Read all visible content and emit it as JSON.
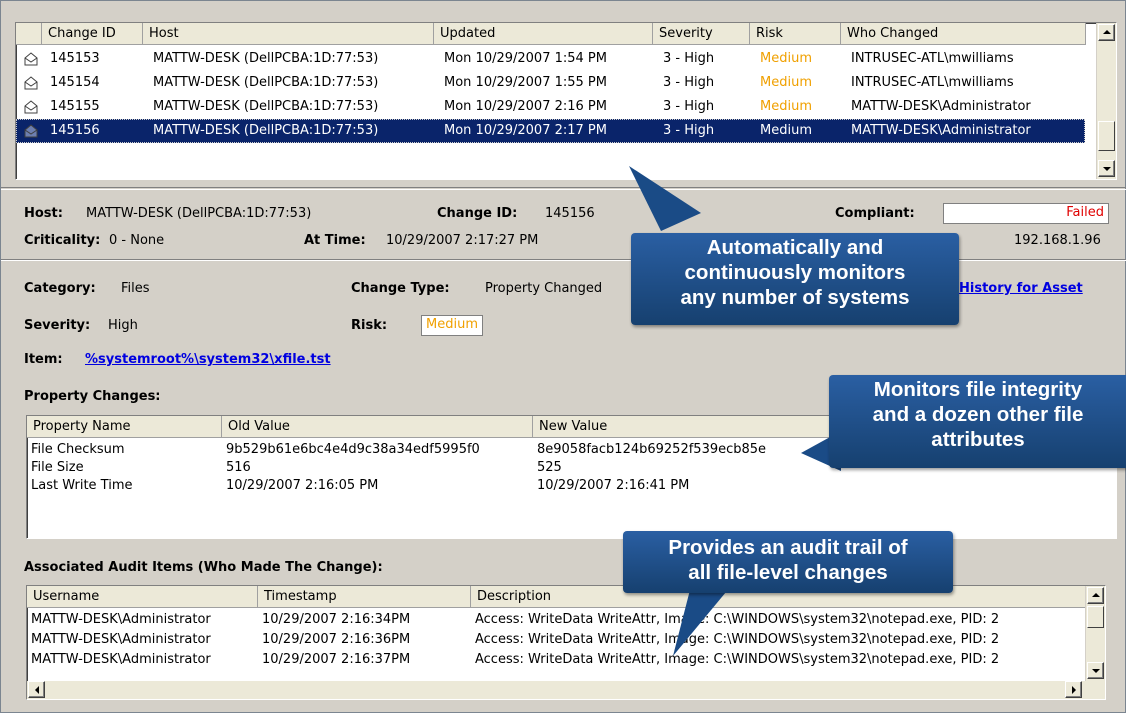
{
  "changes_list": {
    "columns": [
      "Change ID",
      "Host",
      "Updated",
      "Severity",
      "Risk",
      "Who Changed"
    ],
    "rows": [
      {
        "id": "145153",
        "host": "MATTW-DESK (DellPCBA:1D:77:53)",
        "updated": "Mon 10/29/2007 1:54 PM",
        "severity": "3 - High",
        "risk": "Medium",
        "who": "INTRUSEC-ATL\\mwilliams"
      },
      {
        "id": "145154",
        "host": "MATTW-DESK (DellPCBA:1D:77:53)",
        "updated": "Mon 10/29/2007 1:55 PM",
        "severity": "3 - High",
        "risk": "Medium",
        "who": "INTRUSEC-ATL\\mwilliams"
      },
      {
        "id": "145155",
        "host": "MATTW-DESK (DellPCBA:1D:77:53)",
        "updated": "Mon 10/29/2007 2:16 PM",
        "severity": "3 - High",
        "risk": "Medium",
        "who": "MATTW-DESK\\Administrator"
      },
      {
        "id": "145156",
        "host": "MATTW-DESK (DellPCBA:1D:77:53)",
        "updated": "Mon 10/29/2007 2:17 PM",
        "severity": "3 - High",
        "risk": "Medium",
        "who": "MATTW-DESK\\Administrator"
      }
    ],
    "selected_index": 3
  },
  "detail": {
    "host_label": "Host:",
    "host_value": "MATTW-DESK (DellPCBA:1D:77:53)",
    "change_id_label": "Change ID:",
    "change_id_value": "145156",
    "compliant_label": "Compliant:",
    "compliant_value": "Failed",
    "criticality_label": "Criticality:",
    "criticality_value": "0 - None",
    "at_time_label": "At Time:",
    "at_time_value": "10/29/2007 2:17:27 PM",
    "ip_value": "192.168.1.96",
    "category_label": "Category:",
    "category_value": "Files",
    "change_type_label": "Change Type:",
    "change_type_value": "Property Changed",
    "history_link": "History for Asset",
    "severity_label": "Severity:",
    "severity_value": "High",
    "risk_label": "Risk:",
    "risk_value": "Medium",
    "item_label": "Item:",
    "item_value": "%systemroot%\\system32\\xfile.tst"
  },
  "property_changes": {
    "title": "Property Changes:",
    "columns": [
      "Property Name",
      "Old Value",
      "New Value"
    ],
    "rows": [
      {
        "name": "File Checksum",
        "old": "9b529b61e6bc4e4d9c38a34edf5995f0",
        "new": "8e9058facb124b69252f539ecb85e"
      },
      {
        "name": "File Size",
        "old": "516",
        "new": "525"
      },
      {
        "name": "Last Write Time",
        "old": "10/29/2007 2:16:05 PM",
        "new": "10/29/2007 2:16:41 PM"
      }
    ]
  },
  "audit_items": {
    "title": "Associated Audit Items (Who Made The Change):",
    "columns": [
      "Username",
      "Timestamp",
      "Description"
    ],
    "rows": [
      {
        "user": "MATTW-DESK\\Administrator",
        "ts": "10/29/2007 2:16:34PM",
        "desc": "Access: WriteData WriteAttr, Image: C:\\WINDOWS\\system32\\notepad.exe, PID: 2"
      },
      {
        "user": "MATTW-DESK\\Administrator",
        "ts": "10/29/2007 2:16:36PM",
        "desc": "Access: WriteData WriteAttr, Image: C:\\WINDOWS\\system32\\notepad.exe, PID: 2"
      },
      {
        "user": "MATTW-DESK\\Administrator",
        "ts": "10/29/2007 2:16:37PM",
        "desc": "Access: WriteData WriteAttr, Image: C:\\WINDOWS\\system32\\notepad.exe, PID: 2"
      }
    ]
  },
  "callouts": {
    "monitors_systems": [
      "Automatically and",
      "continuously monitors",
      "any number of systems"
    ],
    "file_integrity": [
      "Monitors file integrity",
      "and a dozen other file",
      "attributes"
    ],
    "audit_trail": [
      "Provides an audit trail of",
      "all file-level changes"
    ]
  },
  "colors": {
    "callout": "#1f4e8c",
    "selection": "#0a246a",
    "medium_risk": "#f0a000",
    "failed": "#e00000",
    "link": "#0000e0"
  },
  "icons": {
    "row_icon": "envelope-icon"
  }
}
